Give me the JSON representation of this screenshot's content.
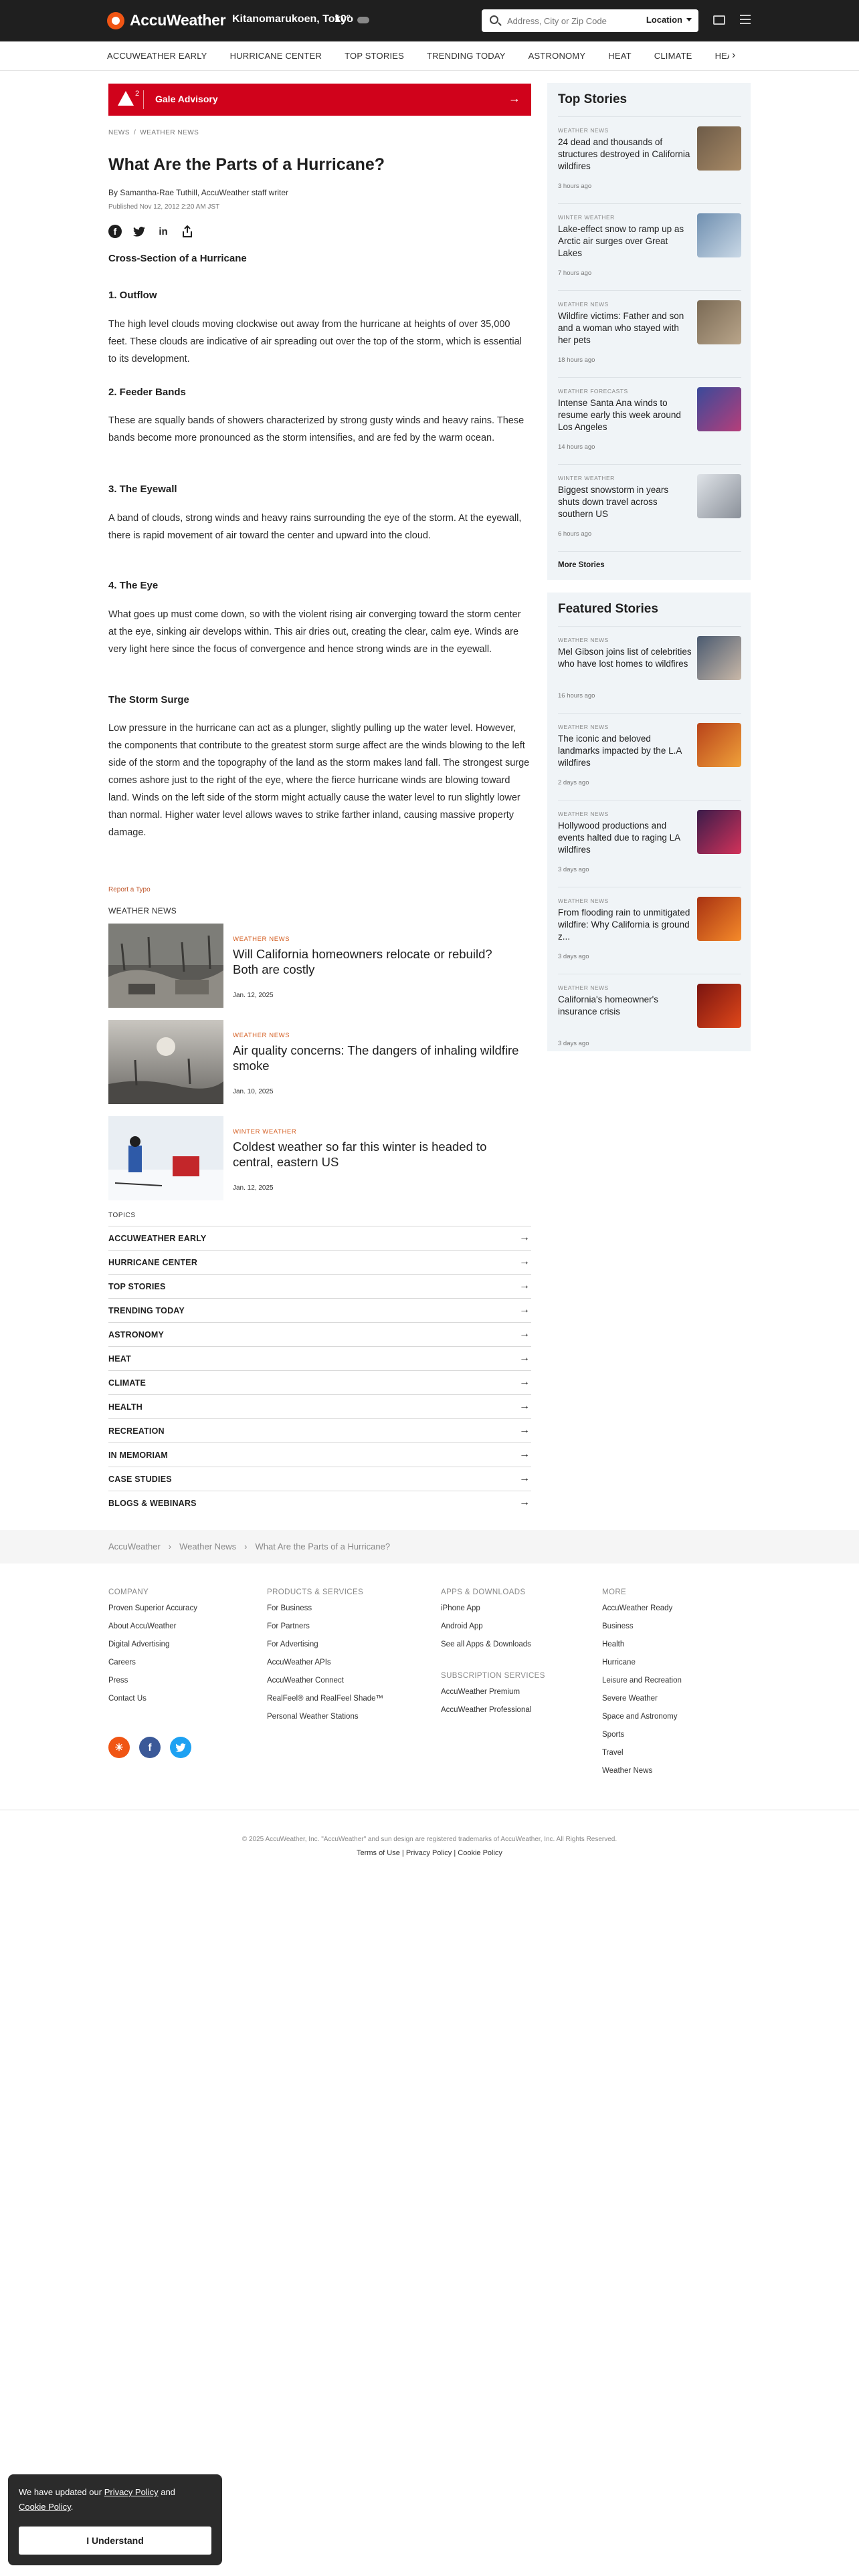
{
  "header": {
    "logo": "AccuWeather",
    "location": "Kitanomarukoen, Tokyo",
    "temperature": "10°",
    "search_placeholder": "Address, City or Zip Code",
    "location_button": "Location"
  },
  "subnav": [
    "ACCUWEATHER EARLY",
    "HURRICANE CENTER",
    "TOP STORIES",
    "TRENDING TODAY",
    "ASTRONOMY",
    "HEAT",
    "CLIMATE",
    "HEALTH"
  ],
  "advisory": {
    "count": "2",
    "label": "Gale Advisory"
  },
  "breadcrumb": [
    "NEWS",
    "WEATHER NEWS"
  ],
  "article": {
    "title": "What Are the Parts of a Hurricane?",
    "author": "By Samantha-Rae Tuthill, AccuWeather staff writer",
    "published": "Published Nov 12, 2012 2:20 AM JST",
    "intro_heading": "Cross-Section of a Hurricane",
    "sections": [
      {
        "heading": "1. Outflow",
        "text": "The high level clouds moving clockwise out away from the hurricane at heights of over 35,000 feet. These clouds are indicative of air spreading out over the top of the storm, which is essential to its development."
      },
      {
        "heading": "2. Feeder Bands",
        "text": "These are squally bands of showers characterized by strong gusty winds and heavy rains. These bands become more pronounced as the storm intensifies, and are fed by the warm ocean."
      },
      {
        "heading": "3. The Eyewall",
        "text": "A band of clouds, strong winds and heavy rains surrounding the eye of the storm. At the eyewall, there is rapid movement of air toward the center and upward into the cloud."
      },
      {
        "heading": "4. The Eye",
        "text": "What goes up must come down, so with the violent rising air converging toward the storm center at the eye, sinking air develops within. This air dries out, creating the clear, calm eye. Winds are very light here since the focus of convergence and hence strong winds are in the eyewall."
      },
      {
        "heading": "The Storm Surge",
        "text": "Low pressure in the hurricane can act as a plunger, slightly pulling up the water level. However, the components that contribute to the greatest storm surge affect are the winds blowing to the left side of the storm and the topography of the land as the storm makes land fall. The strongest surge comes ashore just to the right of the eye, where the fierce hurricane winds are blowing toward land. Winds on the left side of the storm might actually cause the water level to run slightly lower than normal. Higher water level allows waves to strike farther inland, causing massive property damage."
      }
    ],
    "report_typo": "Report a Typo"
  },
  "weather_news_label": "WEATHER NEWS",
  "weather_news": [
    {
      "category": "WEATHER NEWS",
      "title": "Will California homeowners relocate or rebuild? Both are costly",
      "date": "Jan. 12, 2025"
    },
    {
      "category": "WEATHER NEWS",
      "title": "Air quality concerns: The dangers of inhaling wildfire smoke",
      "date": "Jan. 10, 2025"
    },
    {
      "category": "WINTER WEATHER",
      "title": "Coldest weather so far this winter is headed to central, eastern US",
      "date": "Jan. 12, 2025"
    }
  ],
  "topics_label": "TOPICS",
  "topics": [
    "ACCUWEATHER EARLY",
    "HURRICANE CENTER",
    "TOP STORIES",
    "TRENDING TODAY",
    "ASTRONOMY",
    "HEAT",
    "CLIMATE",
    "HEALTH",
    "RECREATION",
    "IN MEMORIAM",
    "CASE STUDIES",
    "BLOGS & WEBINARS"
  ],
  "top_stories": {
    "title": "Top Stories",
    "items": [
      {
        "category": "WEATHER NEWS",
        "title": "24 dead and thousands of structures destroyed in California wildfires",
        "time": "3 hours ago"
      },
      {
        "category": "WINTER WEATHER",
        "title": "Lake-effect snow to ramp up as Arctic air surges over Great Lakes",
        "time": "7 hours ago"
      },
      {
        "category": "WEATHER NEWS",
        "title": "Wildfire victims: Father and son and a woman who stayed with her pets",
        "time": "18 hours ago"
      },
      {
        "category": "WEATHER FORECASTS",
        "title": "Intense Santa Ana winds to resume early this week around Los Angeles",
        "time": "14 hours ago"
      },
      {
        "category": "WINTER WEATHER",
        "title": "Biggest snowstorm in years shuts down travel across southern US",
        "time": "6 hours ago"
      }
    ],
    "more": "More Stories"
  },
  "featured_stories": {
    "title": "Featured Stories",
    "items": [
      {
        "category": "WEATHER NEWS",
        "title": "Mel Gibson joins list of celebrities who have lost homes to wildfires",
        "time": "16 hours ago"
      },
      {
        "category": "WEATHER NEWS",
        "title": "The iconic and beloved landmarks impacted by the L.A wildfires",
        "time": "2 days ago"
      },
      {
        "category": "WEATHER NEWS",
        "title": "Hollywood productions and events halted due to raging LA wildfires",
        "time": "3 days ago"
      },
      {
        "category": "WEATHER NEWS",
        "title": "From flooding rain to unmitigated wildfire: Why California is ground z...",
        "time": "3 days ago"
      },
      {
        "category": "WEATHER NEWS",
        "title": "California's homeowner's insurance crisis",
        "time": "3 days ago"
      }
    ]
  },
  "footer_breadcrumb": [
    "AccuWeather",
    "Weather News",
    "What Are the Parts of a Hurricane?"
  ],
  "footer": {
    "company": {
      "heading": "COMPANY",
      "links": [
        "Proven Superior Accuracy",
        "About AccuWeather",
        "Digital Advertising",
        "Careers",
        "Press",
        "Contact Us"
      ]
    },
    "products": {
      "heading": "PRODUCTS & SERVICES",
      "links": [
        "For Business",
        "For Partners",
        "For Advertising",
        "AccuWeather APIs",
        "AccuWeather Connect",
        "RealFeel® and RealFeel Shade™",
        "Personal Weather Stations"
      ]
    },
    "apps": {
      "heading": "APPS & DOWNLOADS",
      "links": [
        "iPhone App",
        "Android App",
        "See all Apps & Downloads"
      ]
    },
    "subscription": {
      "heading": "SUBSCRIPTION SERVICES",
      "links": [
        "AccuWeather Premium",
        "AccuWeather Professional"
      ]
    },
    "more": {
      "heading": "MORE",
      "links": [
        "AccuWeather Ready",
        "Business",
        "Health",
        "Hurricane",
        "Leisure and Recreation",
        "Severe Weather",
        "Space and Astronomy",
        "Sports",
        "Travel",
        "Weather News"
      ]
    },
    "copyright": "© 2025 AccuWeather, Inc. \"AccuWeather\" and sun design are registered trademarks of AccuWeather, Inc. All Rights Reserved.",
    "terms": "Terms of Use",
    "privacy": "Privacy Policy",
    "cookie": "Cookie Policy"
  },
  "cookie_banner": {
    "text_pre": "We have updated our ",
    "privacy_link": "Privacy Policy",
    "text_mid": " and ",
    "cookie_link": "Cookie Policy",
    "text_post": ".",
    "button": "I Understand"
  },
  "colors": {
    "accent": "#f05514",
    "advisory": "#d0021b",
    "category": "#d45f23",
    "header": "#1f1f1f"
  }
}
